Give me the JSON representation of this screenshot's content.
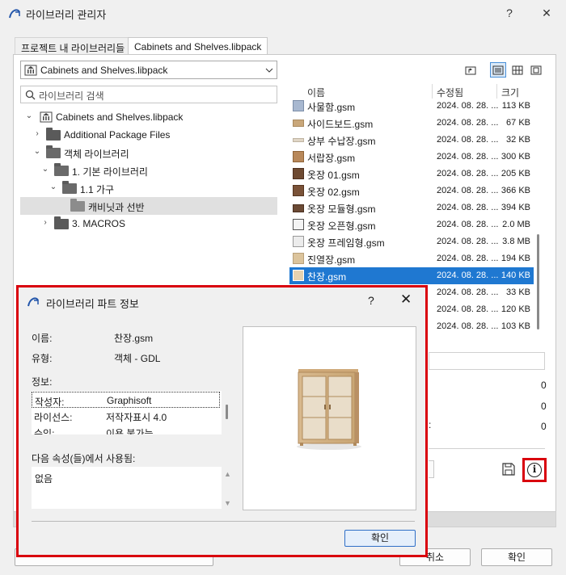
{
  "window": {
    "title": "라이브러리 관리자",
    "help": "?",
    "close": "✕"
  },
  "tabs": [
    {
      "label": "프로젝트 내 라이브러리들"
    },
    {
      "label": "Cabinets and Shelves.libpack"
    }
  ],
  "combo": {
    "value": "Cabinets and Shelves.libpack"
  },
  "search": {
    "placeholder": "라이브러리 검색"
  },
  "tree": [
    {
      "label": "Cabinets and Shelves.libpack"
    },
    {
      "label": "Additional Package Files"
    },
    {
      "label": "객체 라이브러리"
    },
    {
      "label": "1. 기본 라이브러리"
    },
    {
      "label": "1.1 가구"
    },
    {
      "label": "캐비닛과 선반"
    },
    {
      "label": "3. MACROS"
    }
  ],
  "list": {
    "headers": {
      "name": "이름",
      "modified": "수정됨",
      "size": "크기"
    },
    "rows": [
      {
        "name": "사물함.gsm",
        "date": "2024. 08. 28. ...",
        "size": "113 KB"
      },
      {
        "name": "사이드보드.gsm",
        "date": "2024. 08. 28. ...",
        "size": "67 KB"
      },
      {
        "name": "상부 수납장.gsm",
        "date": "2024. 08. 28. ...",
        "size": "32 KB"
      },
      {
        "name": "서랍장.gsm",
        "date": "2024. 08. 28. ...",
        "size": "300 KB"
      },
      {
        "name": "옷장 01.gsm",
        "date": "2024. 08. 28. ...",
        "size": "205 KB"
      },
      {
        "name": "옷장 02.gsm",
        "date": "2024. 08. 28. ...",
        "size": "366 KB"
      },
      {
        "name": "옷장 모듈형.gsm",
        "date": "2024. 08. 28. ...",
        "size": "394 KB"
      },
      {
        "name": "옷장 오픈형.gsm",
        "date": "2024. 08. 28. ...",
        "size": "2.0 MB"
      },
      {
        "name": "옷장 프레임형.gsm",
        "date": "2024. 08. 28. ...",
        "size": "3.8 MB"
      },
      {
        "name": "진열장.gsm",
        "date": "2024. 08. 28. ...",
        "size": "194 KB"
      },
      {
        "name": "찬장.gsm",
        "date": "2024. 08. 28. ...",
        "size": "140 KB"
      },
      {
        "name": "",
        "date": "2024. 08. 28. ...",
        "size": "33 KB"
      },
      {
        "name": "",
        "date": "2024. 08. 28. ...",
        "size": "120 KB"
      },
      {
        "name": "",
        "date": "2024. 08. 28. ...",
        "size": "103 KB"
      }
    ]
  },
  "right_values": [
    "0",
    "0",
    "0"
  ],
  "right_colon": ":",
  "bottom": {
    "cancel": "취소",
    "ok": "확인"
  },
  "dialog": {
    "title": "라이브러리 파트 정보",
    "help": "?",
    "close": "✕",
    "name_label": "이름:",
    "name_value": "찬장.gsm",
    "type_label": "유형:",
    "type_value": "객체 - GDL",
    "info_label": "정보:",
    "info_rows": [
      {
        "key": "작성자:",
        "value": "Graphisoft"
      },
      {
        "key": "라이선스:",
        "value": "저작자표시 4.0"
      },
      {
        "key": "수익:",
        "value": "이용 불가능"
      }
    ],
    "used_label": "다음 속성(들)에서 사용됨:",
    "used_value": "없음",
    "ok": "확인"
  }
}
